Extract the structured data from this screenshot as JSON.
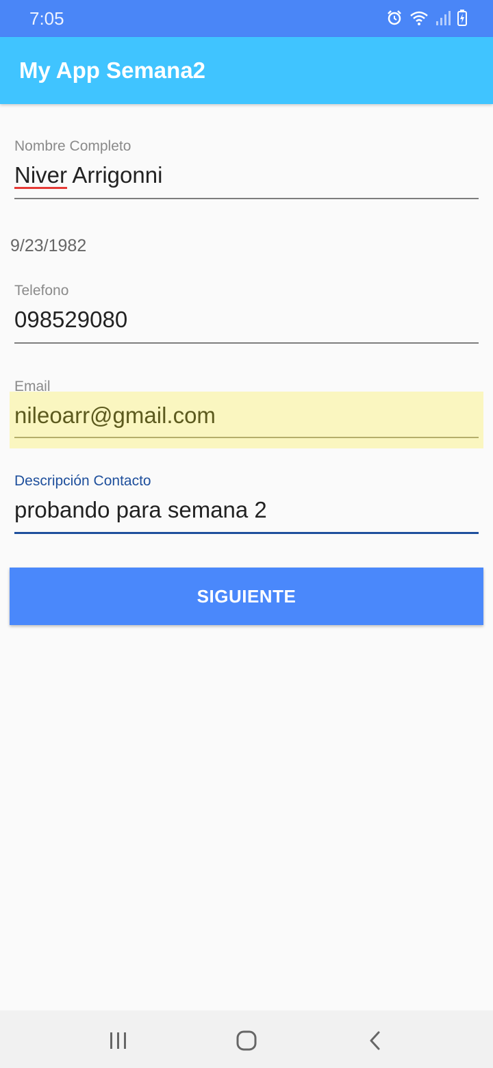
{
  "status_bar": {
    "time": "7:05",
    "icons": [
      "alarm-icon",
      "wifi-icon",
      "signal-icon",
      "battery-icon"
    ]
  },
  "app_bar": {
    "title": "My App Semana2",
    "color": "#40c4ff"
  },
  "form": {
    "nombre": {
      "label": "Nombre Completo",
      "value_first": "Niver",
      "value_rest": " Arrigonni"
    },
    "fecha": {
      "value": "9/23/1982"
    },
    "telefono": {
      "label": "Telefono",
      "value": "098529080"
    },
    "email": {
      "label": "Email",
      "value": "nileoarr@gmail.com"
    },
    "descripcion": {
      "label": "Descripción Contacto",
      "value": "probando para semana 2"
    }
  },
  "actions": {
    "next_label": "SIGUIENTE",
    "button_color": "#4a88fb"
  },
  "nav_bar": {
    "buttons": [
      "recent-apps-icon",
      "home-icon",
      "back-icon"
    ]
  }
}
